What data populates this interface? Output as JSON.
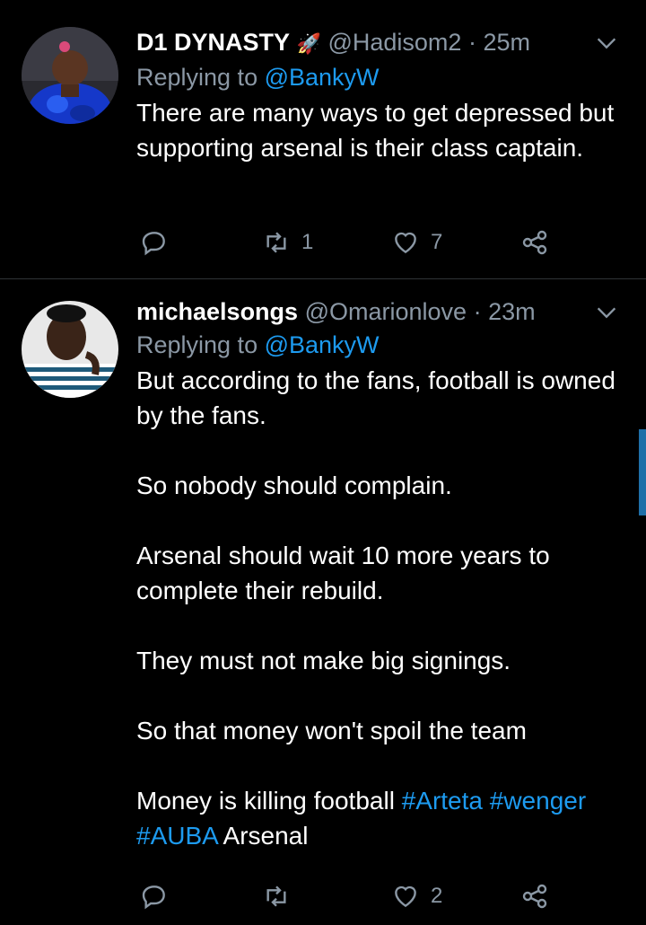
{
  "tweets": [
    {
      "name": "D1 DYNASTY",
      "name_emoji": "🚀",
      "handle": "@Hadisom2",
      "separator": "·",
      "time": "25m",
      "replying_prefix": "Replying to",
      "replying_to": "@BankyW",
      "text": [
        "There are many ways to get depressed but supporting arsenal is their class captain."
      ],
      "retweets": "1",
      "likes": "7"
    },
    {
      "name": "michaelsongs",
      "handle": "@Omarionlove",
      "separator": "·",
      "time": "23m",
      "replying_prefix": "Replying to",
      "replying_to": "@BankyW",
      "text": [
        "But according to the fans, football is owned by the fans.",
        "So nobody should complain.",
        "Arsenal should wait 10 more years to complete their rebuild.",
        "They must not make big signings.",
        "So that money won't spoil the team"
      ],
      "last_para": {
        "text": "Money is killing football",
        "hashtags": [
          "#Arteta",
          "#wenger",
          "#AUBA"
        ],
        "suffix": "Arsenal"
      },
      "retweets": "",
      "likes": "2"
    }
  ],
  "colors": {
    "background": "#000000",
    "text": "#ffffff",
    "muted": "#8b98a5",
    "link": "#1d9bf0",
    "divider": "#2f3336"
  },
  "icons": [
    "reply-icon",
    "retweet-icon",
    "like-icon",
    "share-icon",
    "chevron-down-icon"
  ]
}
